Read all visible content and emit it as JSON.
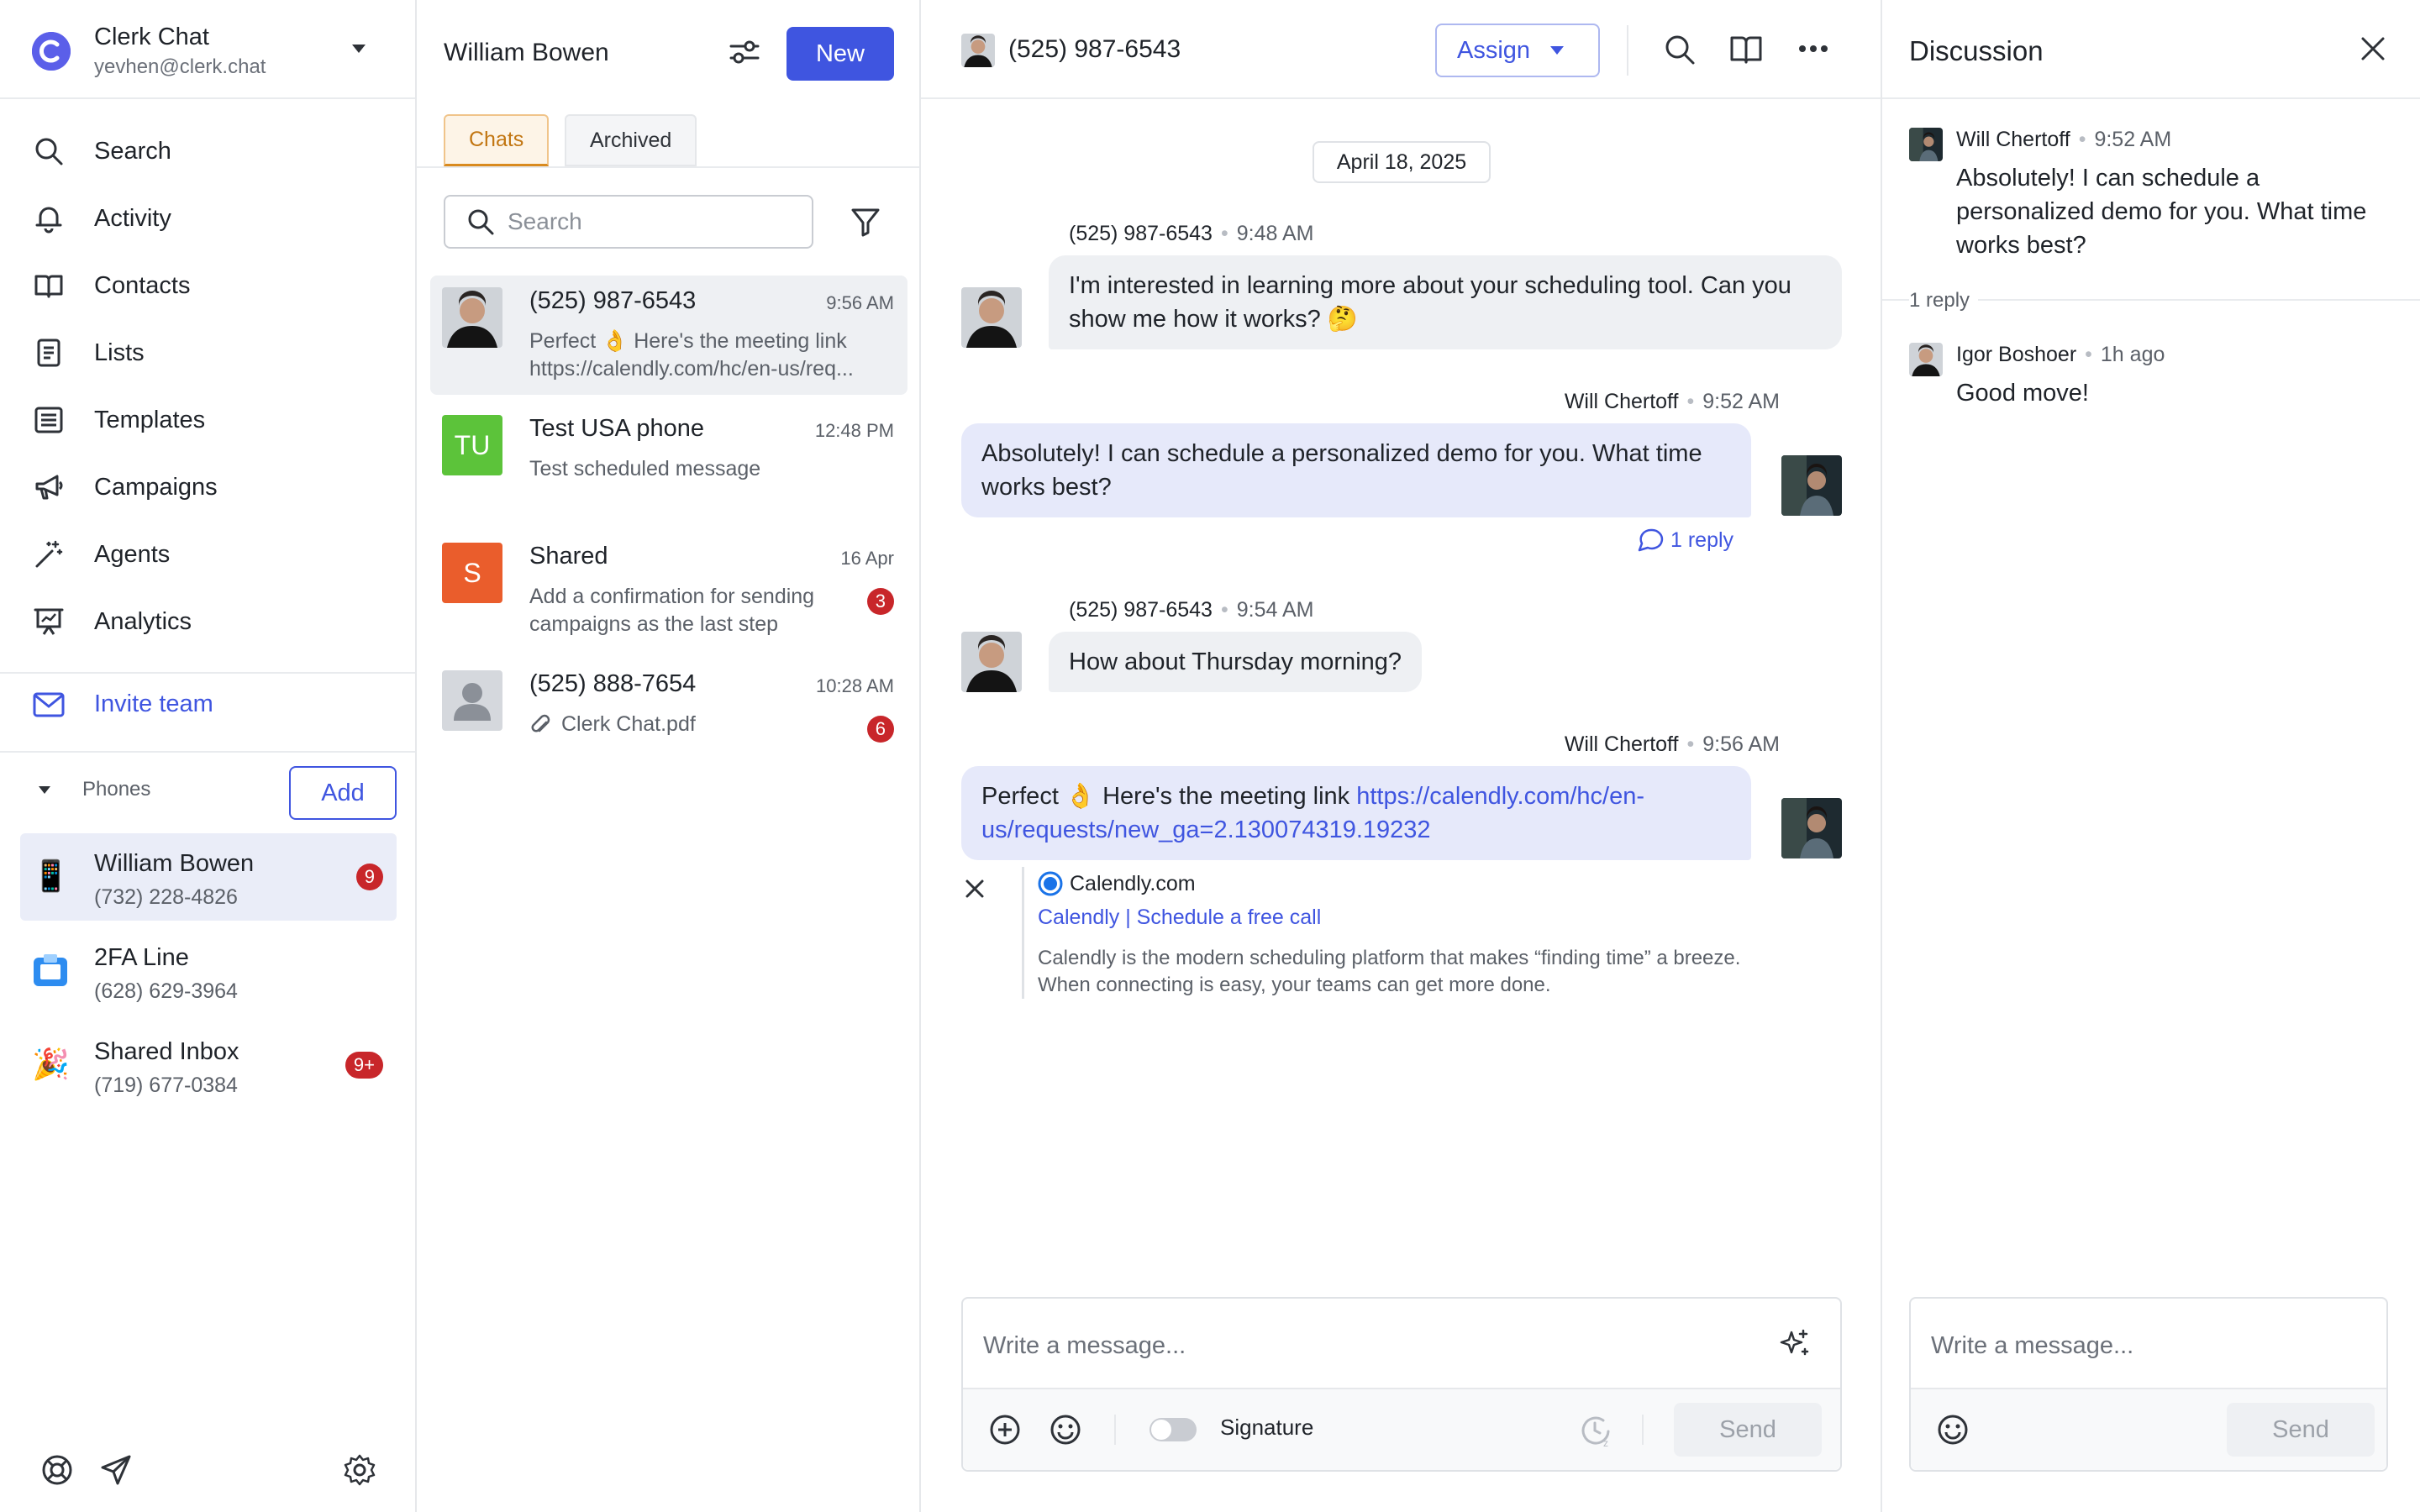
{
  "workspace": {
    "name": "Clerk Chat",
    "email": "yevhen@clerk.chat"
  },
  "nav": [
    {
      "label": "Search",
      "icon": "search-icon"
    },
    {
      "label": "Activity",
      "icon": "bell-icon"
    },
    {
      "label": "Contacts",
      "icon": "book-icon"
    },
    {
      "label": "Lists",
      "icon": "list-icon"
    },
    {
      "label": "Templates",
      "icon": "template-icon"
    },
    {
      "label": "Campaigns",
      "icon": "megaphone-icon"
    },
    {
      "label": "Agents",
      "icon": "magic-wand-icon"
    },
    {
      "label": "Analytics",
      "icon": "presentation-chart-icon"
    }
  ],
  "invite": {
    "label": "Invite team"
  },
  "phones": {
    "header": "Phones",
    "add_label": "Add",
    "items": [
      {
        "name": "William Bowen",
        "number": "(732) 228-4826",
        "badge": "9",
        "emoji": "📱"
      },
      {
        "name": "2FA Line",
        "number": "(628) 629-3964",
        "badge": "",
        "emoji": "📠"
      },
      {
        "name": "Shared Inbox",
        "number": "(719) 677-0384",
        "badge": "9+",
        "emoji": "🎉"
      }
    ]
  },
  "chatlist": {
    "title": "William Bowen",
    "new_label": "New",
    "tabs": [
      "Chats",
      "Archived"
    ],
    "search_placeholder": "Search",
    "items": [
      {
        "name": "(525) 987-6543",
        "time": "9:56 AM",
        "preview": "Perfect 👌 Here's the meeting link\nhttps://calendly.com/hc/en-us/req...",
        "badge": "",
        "initials": ""
      },
      {
        "name": "Test USA phone",
        "time": "12:48 PM",
        "preview": "Test scheduled message",
        "badge": "",
        "initials": "TU"
      },
      {
        "name": "Shared",
        "time": "16 Apr",
        "preview": "Add a confirmation for sending\ncampaigns as the last step",
        "badge": "3",
        "initials": "S"
      },
      {
        "name": "(525) 888-7654",
        "time": "10:28 AM",
        "preview": "Clerk Chat.pdf",
        "badge": "6",
        "initials": ""
      }
    ]
  },
  "conversation": {
    "phone": "(525) 987-6543",
    "assign_label": "Assign",
    "date": "April 18, 2025",
    "messages": [
      {
        "sender": "(525) 987-6543",
        "time": "9:48 AM",
        "text": "I'm interested in learning more about your scheduling tool. Can you show me how it works? 🤔"
      },
      {
        "sender": "Will Chertoff",
        "time": "9:52 AM",
        "text": "Absolutely! I can schedule a personalized demo for you. What time works best?",
        "replies": "1 reply"
      },
      {
        "sender": "(525) 987-6543",
        "time": "9:54 AM",
        "text": "How about Thursday morning?"
      },
      {
        "sender": "Will Chertoff",
        "time": "9:56 AM",
        "text": "Perfect 👌 Here's the meeting link ",
        "link": "https://calendly.com/hc/en-us/requests/new_ga=2.130074319.19232"
      }
    ],
    "preview": {
      "site": "Calendly.com",
      "title": "Calendly | Schedule a free call",
      "description": "Calendly is the modern scheduling platform that makes “finding time” a breeze. When connecting is easy, your teams can get more done."
    },
    "composer": {
      "placeholder": "Write a message...",
      "signature_label": "Signature",
      "send_label": "Send"
    }
  },
  "discussion": {
    "title": "Discussion",
    "root": {
      "name": "Will Chertoff",
      "time": "9:52 AM",
      "text": "Absolutely! I can schedule a personalized demo for you. What time works best?"
    },
    "replies_count": "1 reply",
    "reply": {
      "name": "Igor Boshoer",
      "time": "1h ago",
      "text": "Good move!"
    },
    "composer": {
      "placeholder": "Write a message...",
      "send_label": "Send"
    }
  },
  "colors": {
    "accent": "#3f55e0",
    "badge": "#c8262a",
    "tab_active": "#c27612",
    "avatar_tu": "#5cc33a",
    "avatar_s": "#ea5d2c"
  }
}
